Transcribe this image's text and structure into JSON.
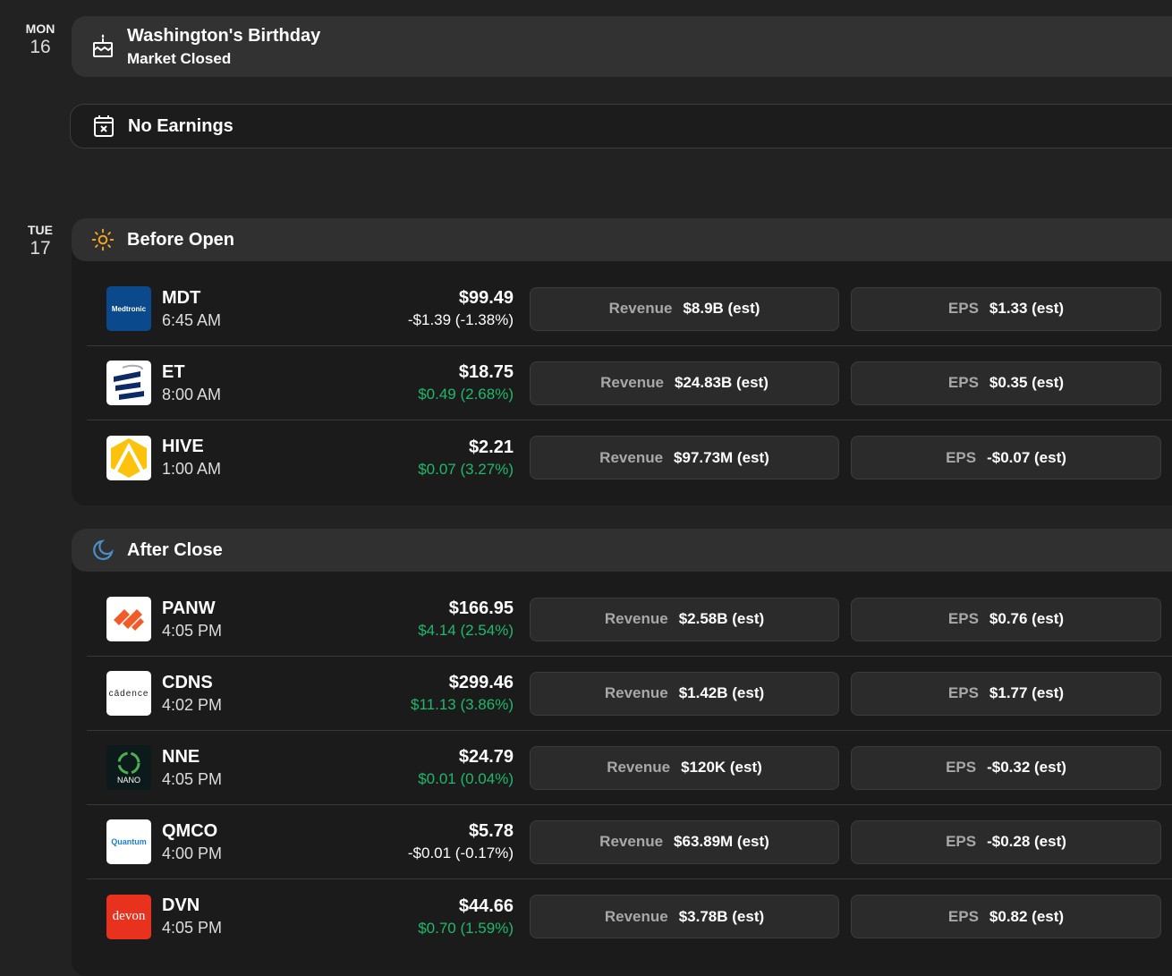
{
  "days": [
    {
      "dow": "MON",
      "num": "16",
      "holiday": {
        "title": "Washington's Birthday",
        "subtitle": "Market Closed"
      },
      "no_earnings": "No Earnings"
    },
    {
      "dow": "TUE",
      "num": "17"
    }
  ],
  "labels": {
    "revenue": "Revenue",
    "eps": "EPS"
  },
  "colors": {
    "up": "#1fb96b",
    "down": "#f0553d",
    "sun": "#f5a623",
    "moon": "#4a8fc9"
  },
  "sections": [
    {
      "title": "Before Open",
      "icon": "sun-icon",
      "rows": [
        {
          "ticker": "MDT",
          "time": "6:45 AM",
          "price": "$99.49",
          "change": "-$1.39 (-1.38%)",
          "dir": "down",
          "revenue": "$8.9B (est)",
          "eps": "$1.33 (est)",
          "logo_text": "Medtronic"
        },
        {
          "ticker": "ET",
          "time": "8:00 AM",
          "price": "$18.75",
          "change": "$0.49 (2.68%)",
          "dir": "up",
          "revenue": "$24.83B (est)",
          "eps": "$0.35 (est)"
        },
        {
          "ticker": "HIVE",
          "time": "1:00 AM",
          "price": "$2.21",
          "change": "$0.07 (3.27%)",
          "dir": "up",
          "revenue": "$97.73M (est)",
          "eps": "-$0.07 (est)"
        }
      ]
    },
    {
      "title": "After Close",
      "icon": "moon-icon",
      "rows": [
        {
          "ticker": "PANW",
          "time": "4:05 PM",
          "price": "$166.95",
          "change": "$4.14 (2.54%)",
          "dir": "up",
          "revenue": "$2.58B (est)",
          "eps": "$0.76 (est)"
        },
        {
          "ticker": "CDNS",
          "time": "4:02 PM",
          "price": "$299.46",
          "change": "$11.13 (3.86%)",
          "dir": "up",
          "revenue": "$1.42B (est)",
          "eps": "$1.77 (est)",
          "logo_text": "cādence"
        },
        {
          "ticker": "NNE",
          "time": "4:05 PM",
          "price": "$24.79",
          "change": "$0.01 (0.04%)",
          "dir": "up",
          "revenue": "$120K (est)",
          "eps": "-$0.32 (est)",
          "logo_text": "NANO"
        },
        {
          "ticker": "QMCO",
          "time": "4:00 PM",
          "price": "$5.78",
          "change": "-$0.01 (-0.17%)",
          "dir": "down",
          "revenue": "$63.89M (est)",
          "eps": "-$0.28 (est)",
          "logo_text": "Quantum"
        },
        {
          "ticker": "DVN",
          "time": "4:05 PM",
          "price": "$44.66",
          "change": "$0.70 (1.59%)",
          "dir": "up",
          "revenue": "$3.78B (est)",
          "eps": "$0.82 (est)",
          "logo_text": "devon"
        }
      ]
    }
  ]
}
